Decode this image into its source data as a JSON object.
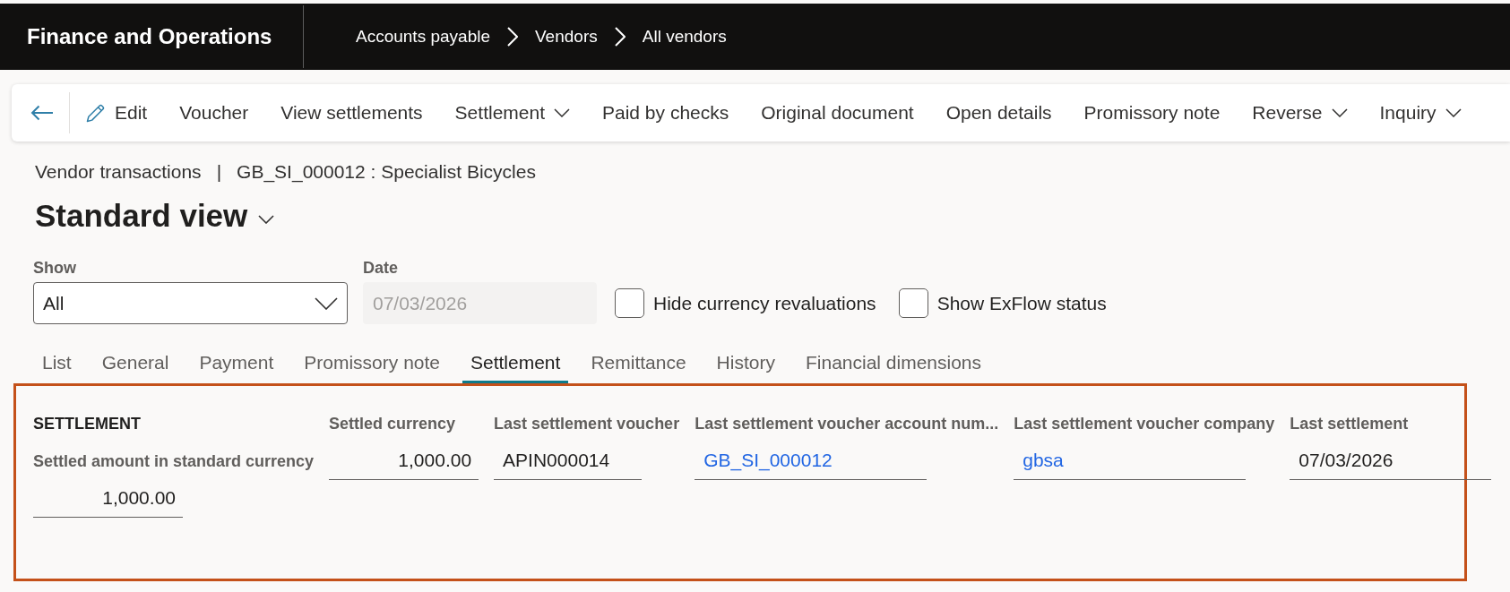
{
  "top_bar": {
    "app_title": "Finance and Operations",
    "breadcrumbs": [
      "Accounts payable",
      "Vendors",
      "All vendors"
    ]
  },
  "toolbar": {
    "items": [
      {
        "label": "Edit",
        "kind": "edit"
      },
      {
        "label": "Voucher",
        "kind": "plain"
      },
      {
        "label": "View settlements",
        "kind": "plain"
      },
      {
        "label": "Settlement",
        "kind": "dropdown"
      },
      {
        "label": "Paid by checks",
        "kind": "plain"
      },
      {
        "label": "Original document",
        "kind": "plain"
      },
      {
        "label": "Open details",
        "kind": "plain"
      },
      {
        "label": "Promissory note",
        "kind": "plain"
      },
      {
        "label": "Reverse",
        "kind": "dropdown"
      },
      {
        "label": "Inquiry",
        "kind": "dropdown"
      }
    ]
  },
  "header": {
    "form_name": "Vendor transactions",
    "separator": "|",
    "record": "GB_SI_000012 : Specialist Bicycles",
    "view_title": "Standard view"
  },
  "filters": {
    "show": {
      "label": "Show",
      "value": "All"
    },
    "date": {
      "label": "Date",
      "value": "07/03/2026",
      "disabled": true
    },
    "checkboxes": [
      {
        "label": "Hide currency revaluations",
        "checked": false
      },
      {
        "label": "Show ExFlow status",
        "checked": false
      }
    ]
  },
  "tabs": [
    {
      "label": "List",
      "selected": false
    },
    {
      "label": "General",
      "selected": false
    },
    {
      "label": "Payment",
      "selected": false
    },
    {
      "label": "Promissory note",
      "selected": false
    },
    {
      "label": "Settlement",
      "selected": true
    },
    {
      "label": "Remittance",
      "selected": false
    },
    {
      "label": "History",
      "selected": false
    },
    {
      "label": "Financial dimensions",
      "selected": false
    }
  ],
  "settlement": {
    "heading": "SETTLEMENT",
    "fields": [
      {
        "label": "Settled amount in standard currency",
        "value": "1,000.00",
        "kind": "amount"
      },
      {
        "label": "Settled currency",
        "value": "1,000.00",
        "kind": "amount"
      },
      {
        "label": "Last settlement voucher",
        "value": "APIN000014",
        "kind": "text"
      },
      {
        "label": "Last settlement voucher account num...",
        "value": "GB_SI_000012",
        "kind": "link"
      },
      {
        "label": "Last settlement voucher company",
        "value": "gbsa",
        "kind": "link"
      },
      {
        "label": "Last settlement",
        "value": "07/03/2026",
        "kind": "date"
      }
    ]
  }
}
